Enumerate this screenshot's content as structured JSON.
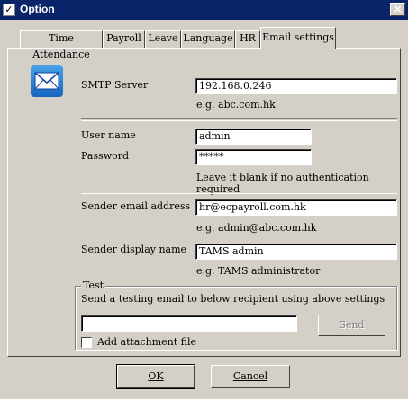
{
  "window": {
    "title": "Option",
    "close_label": "×"
  },
  "tabs": [
    {
      "label": "Time Attendance"
    },
    {
      "label": "Payroll"
    },
    {
      "label": "Leave"
    },
    {
      "label": "Language"
    },
    {
      "label": "HR"
    },
    {
      "label": "Email settings",
      "active": true
    }
  ],
  "smtp": {
    "label": "SMTP Server",
    "value": "192.168.0.246",
    "hint": "e.g. abc.com.hk"
  },
  "auth": {
    "username_label": "User name",
    "username_value": "admin",
    "password_label": "Password",
    "password_value": "*****",
    "hint": "Leave it blank if no authentication required"
  },
  "sender": {
    "email_label": "Sender email address",
    "email_value": "hr@ecpayroll.com.hk",
    "email_hint": "e.g. admin@abc.com.hk",
    "name_label": "Sender display name",
    "name_value": "TAMS admin",
    "name_hint": "e.g. TAMS administrator"
  },
  "test": {
    "group_title": "Test",
    "description": "Send a testing email to below recipient using above settings",
    "recipient_value": "",
    "send_label": "Send",
    "attachment_label": "Add attachment file",
    "attachment_checked": false
  },
  "buttons": {
    "ok_label": "OK",
    "cancel_label": "Cancel"
  },
  "icons": {
    "window_icon": "checkbox-icon",
    "email_icon": "envelope-icon"
  },
  "colors": {
    "title_bar": "#0a246a",
    "dialog_bg": "#d4d0c8",
    "email_icon": "#1e7fd8"
  }
}
